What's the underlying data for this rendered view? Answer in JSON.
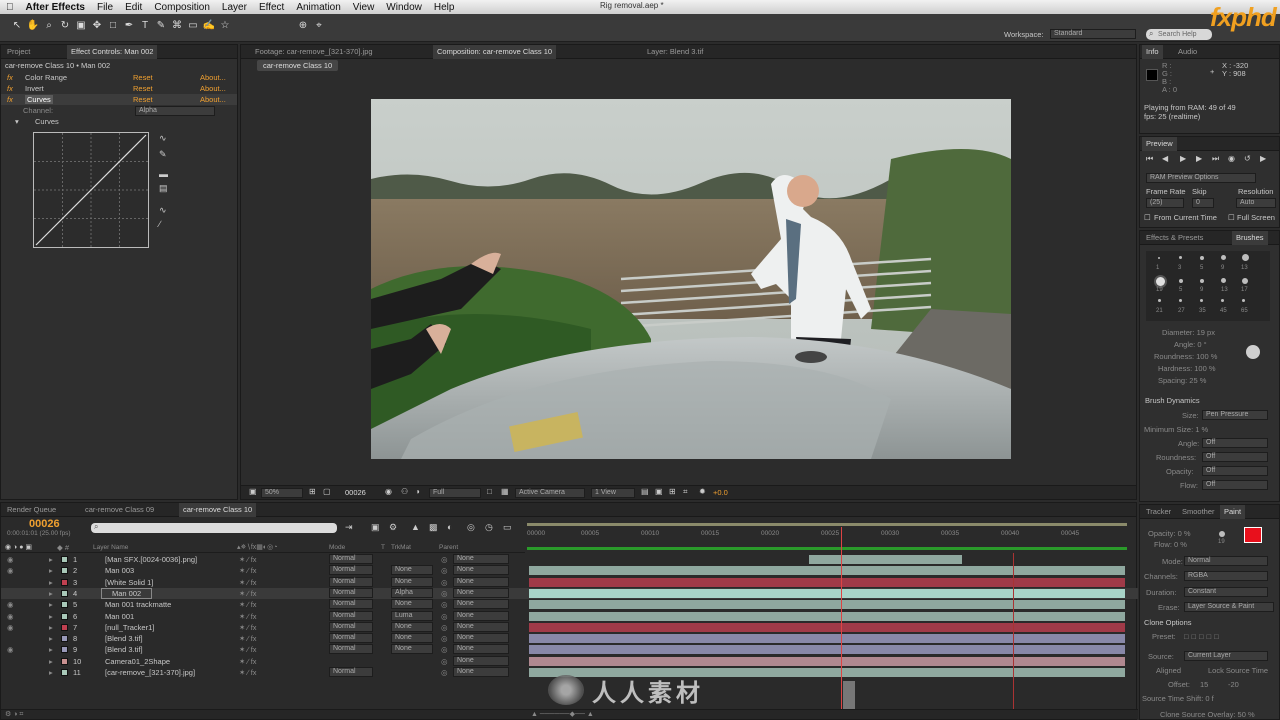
{
  "menubar": {
    "app": "After Effects",
    "items": [
      "File",
      "Edit",
      "Composition",
      "Layer",
      "Effect",
      "Animation",
      "View",
      "Window",
      "Help"
    ],
    "doc_title": "Rig removal.aep *"
  },
  "toolbar": {
    "workspace_label": "Workspace:",
    "workspace_value": "Standard",
    "search_placeholder": "Search Help",
    "logo": "fxphd"
  },
  "left_panel": {
    "tab_project": "Project",
    "tab_effect_controls": "Effect Controls: Man 002",
    "header": "car-remove Class 10 • Man 002",
    "effects": [
      {
        "name": "Color Range",
        "reset": "Reset",
        "about": "About..."
      },
      {
        "name": "Invert",
        "reset": "Reset",
        "about": "About..."
      },
      {
        "name": "Curves",
        "reset": "Reset",
        "about": "About..."
      }
    ],
    "channel_label": "Channel:",
    "channel_value": "Alpha",
    "curves_label": "Curves"
  },
  "viewer": {
    "tabs": [
      "Footage: car-remove_[321-370].jpg",
      "Composition: car-remove Class 10",
      "Layer: Blend 3.tif"
    ],
    "comp_button": "car-remove Class 10",
    "zoom": "50%",
    "timecode": "00026",
    "resolution": "Full",
    "camera": "Active Camera",
    "view": "1 View",
    "exposure": "+0.0"
  },
  "info": {
    "tab_info": "Info",
    "tab_audio": "Audio",
    "r": "R :",
    "g": "G :",
    "b": "B :",
    "a": "A : 0",
    "x": "X : -320",
    "y": "Y : 908",
    "status1": "Playing from RAM: 49 of 49",
    "status2": "fps: 25 (realtime)"
  },
  "preview": {
    "tab": "Preview",
    "ram_options": "RAM Preview Options",
    "frame_rate_label": "Frame Rate",
    "frame_rate": "(25)",
    "skip_label": "Skip",
    "skip": "0",
    "resolution_label": "Resolution",
    "resolution": "Auto",
    "from_current": "From Current Time",
    "full_screen": "Full Screen"
  },
  "brushes": {
    "tab_effects": "Effects & Presets",
    "tab_brushes": "Brushes",
    "sizes": [
      "1",
      "3",
      "5",
      "9",
      "13",
      "19",
      "5",
      "9",
      "13",
      "17",
      "21",
      "27",
      "35",
      "45",
      "65"
    ],
    "diameter": "Diameter: 19 px",
    "angle": "Angle: 0 °",
    "roundness": "Roundness: 100 %",
    "hardness": "Hardness: 100 %",
    "spacing": "Spacing: 25 %",
    "dynamics": "Brush Dynamics",
    "dyn_size": "Size:",
    "dyn_size_v": "Pen Pressure",
    "min_size": "Minimum Size: 1 %",
    "dyn_angle": "Angle:",
    "dyn_roundness": "Roundness:",
    "dyn_opacity": "Opacity:",
    "dyn_flow": "Flow:",
    "off": "Off"
  },
  "paint": {
    "tab_tracker": "Tracker",
    "tab_smoother": "Smoother",
    "tab_paint": "Paint",
    "opacity": "Opacity: 0 %",
    "flow": "Flow: 0 %",
    "brush_size": "19",
    "mode_label": "Mode:",
    "mode": "Normal",
    "channels_label": "Channels:",
    "channels": "RGBA",
    "duration_label": "Duration:",
    "duration": "Constant",
    "erase_label": "Erase:",
    "erase": "Layer Source & Paint",
    "clone_options": "Clone Options",
    "preset_label": "Preset:",
    "source_label": "Source:",
    "source": "Current Layer",
    "aligned": "Aligned",
    "lock_source": "Lock Source Time",
    "offset_label": "Offset:",
    "offset_x": "15",
    "offset_y": "-20",
    "source_time_shift": "Source Time Shift: 0 f",
    "clone_overlay": "Clone Source Overlay: 50 %",
    "accent": "#e8101c"
  },
  "timeline": {
    "tabs": [
      "Render Queue",
      "car-remove Class 09",
      "car-remove Class 10"
    ],
    "timecode": "00026",
    "timecode_sub": "0:00:01:01 (25.00 fps)",
    "col_layer": "Layer Name",
    "col_mode": "Mode",
    "col_t": "T",
    "col_trkmat": "TrkMat",
    "col_parent": "Parent",
    "ruler": [
      "00000",
      "00005",
      "00010",
      "00015",
      "00020",
      "00025",
      "00030",
      "00035",
      "00040",
      "00045"
    ],
    "layers": [
      {
        "num": "1",
        "name": "[Man SFX.[0024-0036].png]",
        "mode": "Normal",
        "trkmat": "",
        "parent": "None",
        "color": "#a8c8b8",
        "bar": "#8fa89f"
      },
      {
        "num": "2",
        "name": "Man 003",
        "mode": "Normal",
        "trkmat": "None",
        "parent": "None",
        "color": "#a8c8b8",
        "bar": "#8fa89f"
      },
      {
        "num": "3",
        "name": "[White Solid 1]",
        "mode": "Normal",
        "trkmat": "None",
        "parent": "None",
        "color": "#c04050",
        "bar": "#a03a48"
      },
      {
        "num": "4",
        "name": "Man 002",
        "mode": "Normal",
        "trkmat": "Alpha",
        "parent": "None",
        "color": "#a8c8b8",
        "bar": "#a8d4c8"
      },
      {
        "num": "5",
        "name": "Man 001 trackmatte",
        "mode": "Normal",
        "trkmat": "None",
        "parent": "None",
        "color": "#a8c8b8",
        "bar": "#8fa89f"
      },
      {
        "num": "6",
        "name": "Man 001",
        "mode": "Normal",
        "trkmat": "Luma",
        "parent": "None",
        "color": "#a8c8b8",
        "bar": "#8fa89f"
      },
      {
        "num": "7",
        "name": "[null_Tracker1]",
        "mode": "Normal",
        "trkmat": "None",
        "parent": "None",
        "color": "#c04050",
        "bar": "#a03a48"
      },
      {
        "num": "8",
        "name": "[Blend 3.tif]",
        "mode": "Normal",
        "trkmat": "None",
        "parent": "None",
        "color": "#9898b8",
        "bar": "#8888a8"
      },
      {
        "num": "9",
        "name": "[Blend 3.tif]",
        "mode": "Normal",
        "trkmat": "None",
        "parent": "None",
        "color": "#9898b8",
        "bar": "#8888a8"
      },
      {
        "num": "10",
        "name": "Camera01_2Shape",
        "mode": "",
        "trkmat": "",
        "parent": "None",
        "color": "#c89090",
        "bar": "#b08890"
      },
      {
        "num": "11",
        "name": "[car-remove_[321-370].jpg]",
        "mode": "Normal",
        "trkmat": "",
        "parent": "None",
        "color": "#a8c8b8",
        "bar": "#8fa89f"
      }
    ]
  },
  "watermark": "人人素材"
}
